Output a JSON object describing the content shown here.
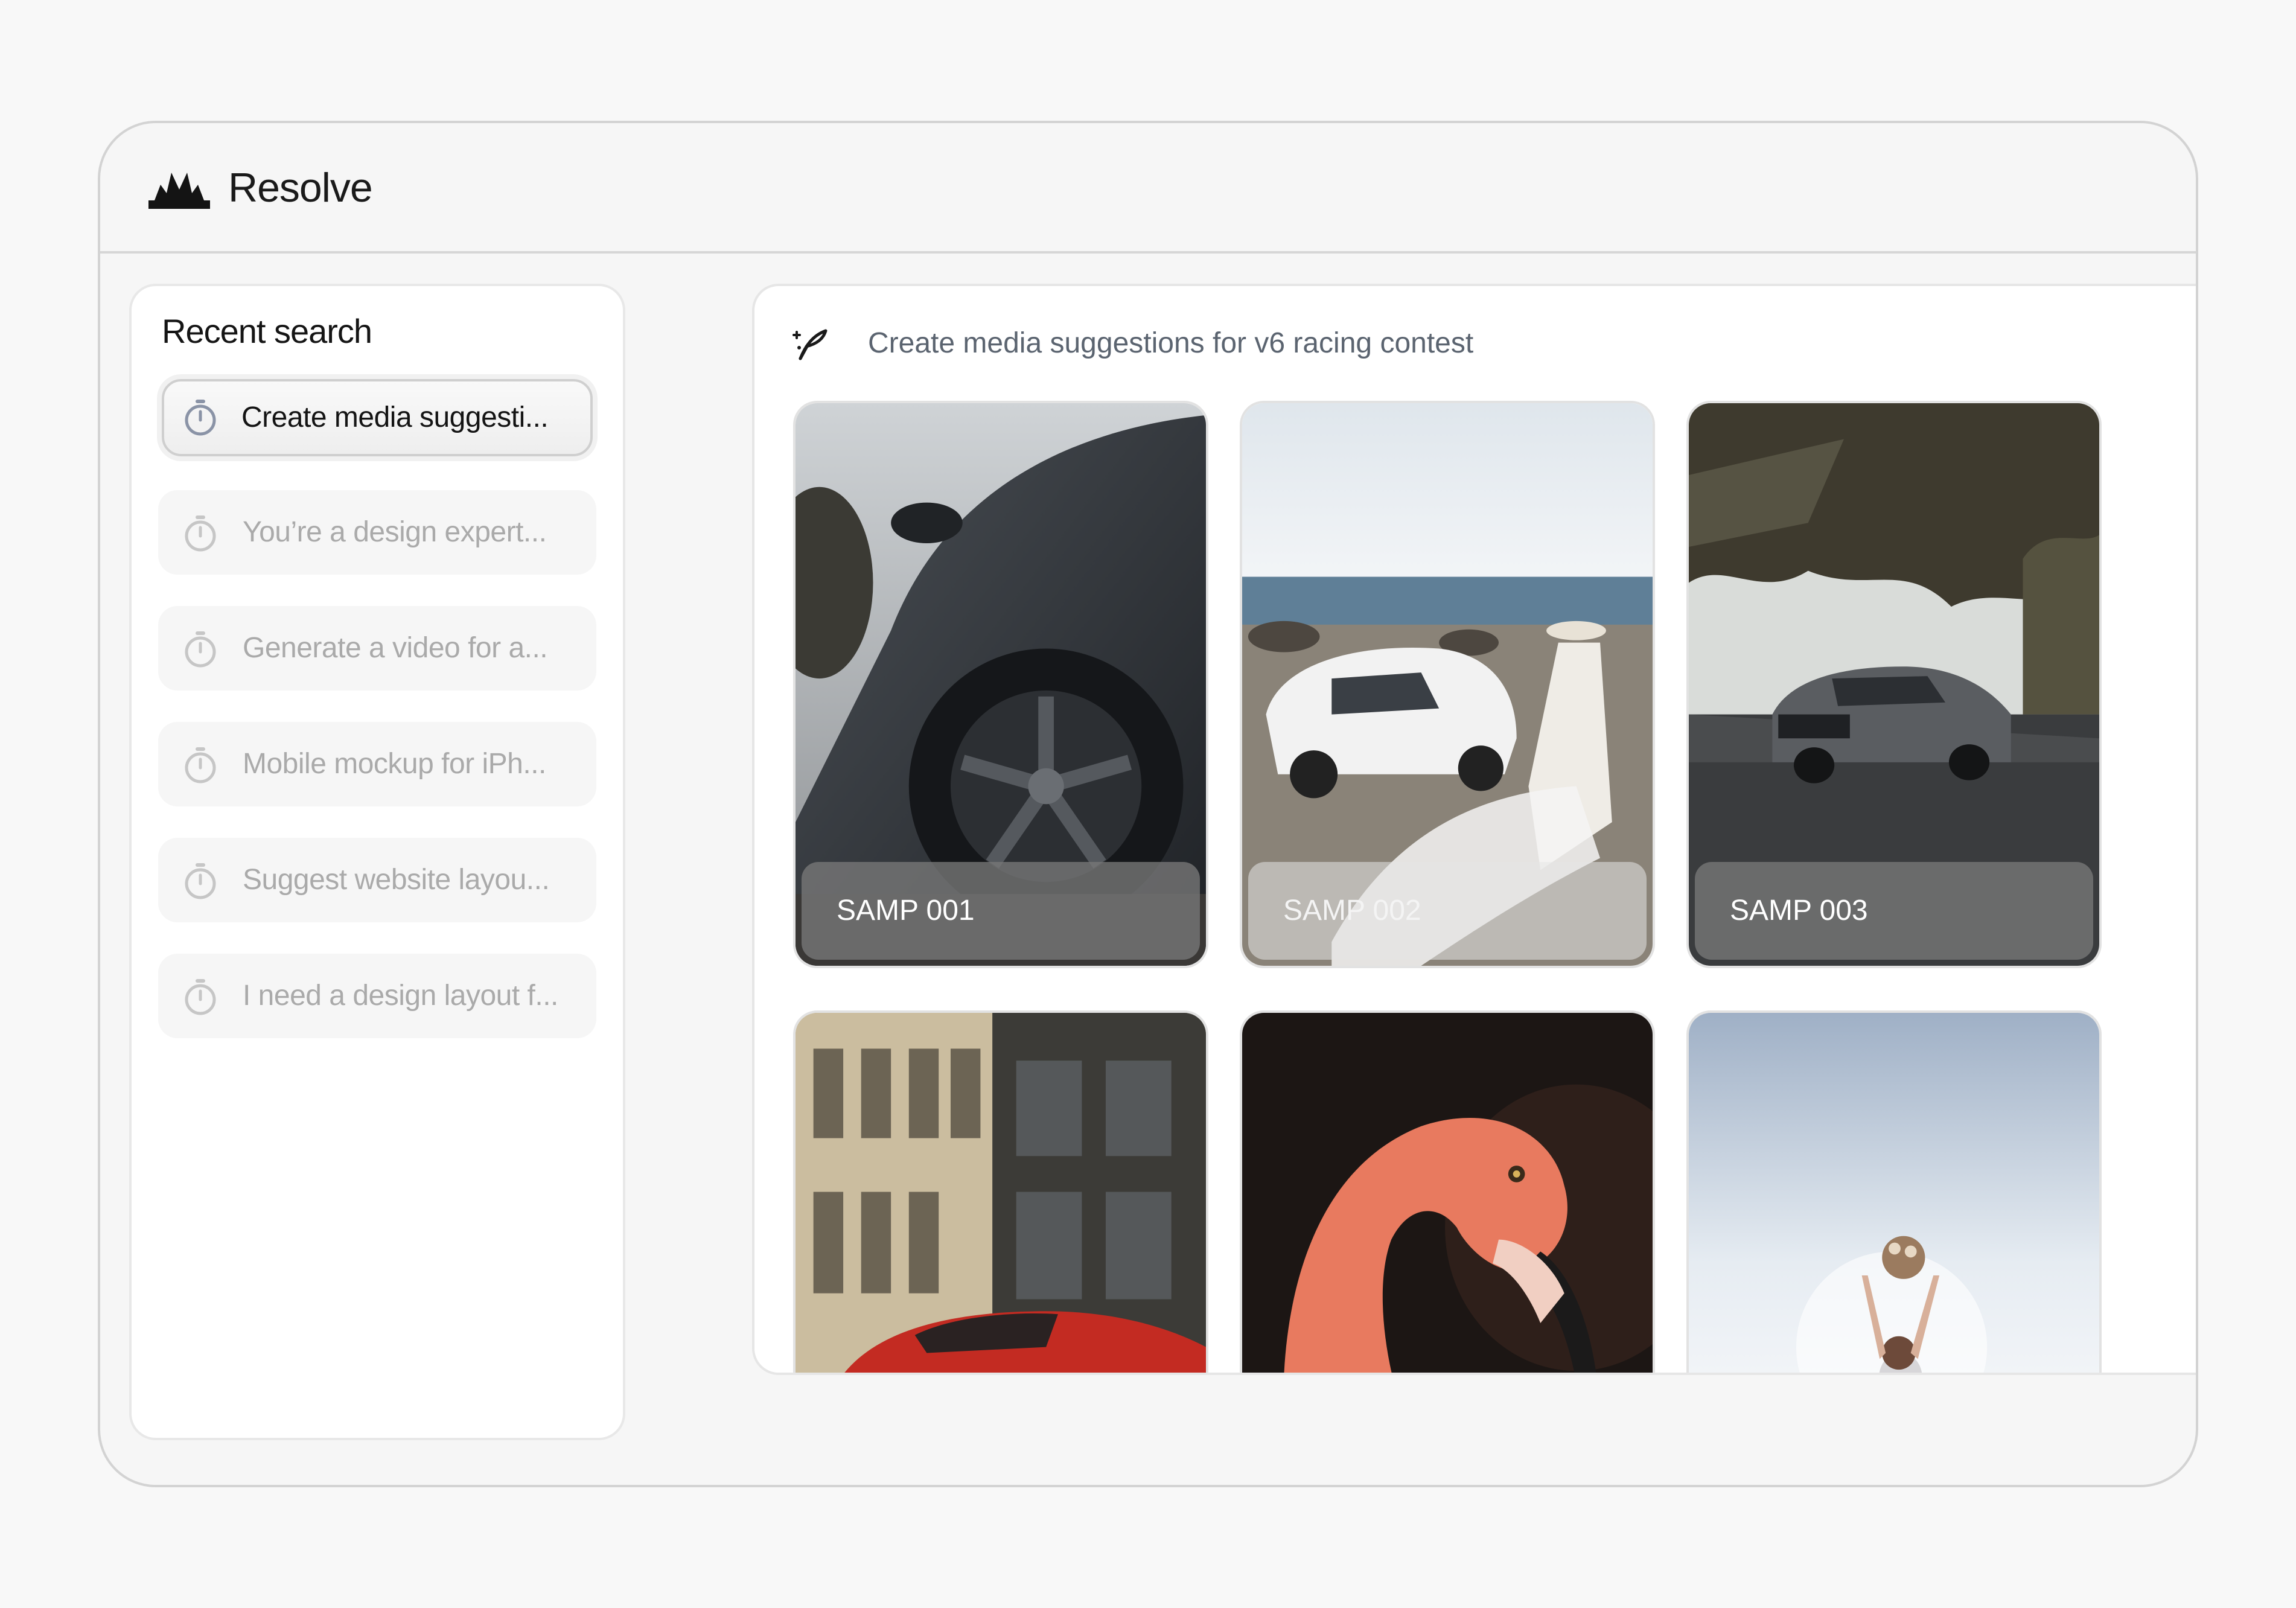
{
  "app": {
    "name": "Resolve"
  },
  "sidebar": {
    "title": "Recent search",
    "items": [
      {
        "label": "Create media suggesti...",
        "active": true
      },
      {
        "label": "You’re a design expert...",
        "active": false
      },
      {
        "label": "Generate a video for a...",
        "active": false
      },
      {
        "label": "Mobile mockup for iPh...",
        "active": false
      },
      {
        "label": "Suggest website layou...",
        "active": false
      },
      {
        "label": "I need a design layout f...",
        "active": false
      }
    ]
  },
  "main": {
    "prompt": "Create media suggestions for v6 racing contest",
    "cards": [
      {
        "label": "SAMP 001",
        "subject": "dark sports car wheel close-up"
      },
      {
        "label": "SAMP 002",
        "subject": "white sports car with bride by the sea"
      },
      {
        "label": "SAMP 003",
        "subject": "grey sedan on road with motion blur"
      },
      {
        "label": "",
        "subject": "red sports car in front of stone building"
      },
      {
        "label": "",
        "subject": "flamingo head on dark background"
      },
      {
        "label": "",
        "subject": "woman holding bouquet against bright sky"
      }
    ]
  },
  "icons": {
    "logo": "resolve-logo-icon",
    "history": "timer-icon",
    "prompt": "sparkle-pen-icon"
  },
  "colors": {
    "brand": "#141414",
    "muted_text": "#aaaaaa",
    "prompt_text": "#5b6470",
    "page_bg": "#f8f8f8",
    "frame_bg": "#f6f6f6"
  }
}
